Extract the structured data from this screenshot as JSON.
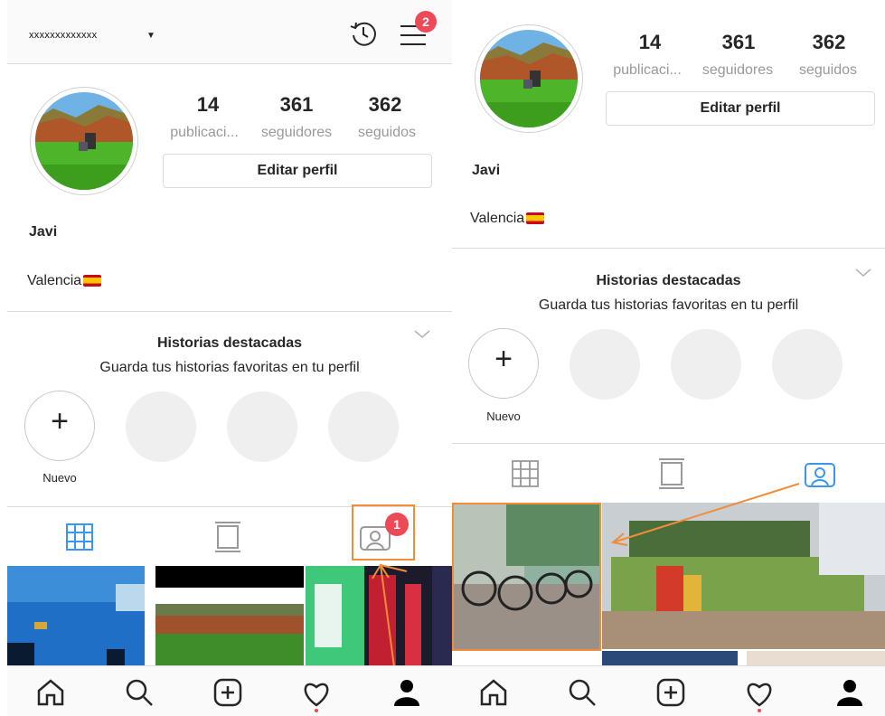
{
  "left": {
    "username": "xxxxxxxxxxxxx",
    "notification_count": "2",
    "tag_badge_count": "1",
    "stats": [
      {
        "value": "14",
        "label": "publicaci..."
      },
      {
        "value": "361",
        "label": "seguidores"
      },
      {
        "value": "362",
        "label": "seguidos"
      }
    ],
    "edit_profile": "Editar perfil",
    "name": "Javi",
    "location": "Valencia",
    "highlights_title": "Historias destacadas",
    "highlights_subtitle": "Guarda tus historias favoritas en tu perfil",
    "new_story_label": "Nuevo"
  },
  "right": {
    "stats": [
      {
        "value": "14",
        "label": "publicaci..."
      },
      {
        "value": "361",
        "label": "seguidores"
      },
      {
        "value": "362",
        "label": "seguidos"
      }
    ],
    "edit_profile": "Editar perfil",
    "name": "Javi",
    "location": "Valencia",
    "highlights_title": "Historias destacadas",
    "highlights_subtitle": "Guarda tus historias favoritas en tu perfil",
    "new_story_label": "Nuevo"
  },
  "icons": {
    "home": "home-icon",
    "search": "search-icon",
    "add": "add-post-icon",
    "activity": "heart-icon",
    "profile": "profile-icon",
    "grid": "grid-icon",
    "igtv": "igtv-icon",
    "tagged": "tagged-icon",
    "history": "history-icon",
    "menu": "menu-icon"
  },
  "colors": {
    "accent_blue": "#3897f0",
    "badge_red": "#ed4956",
    "annotation_orange": "#f28c38"
  }
}
